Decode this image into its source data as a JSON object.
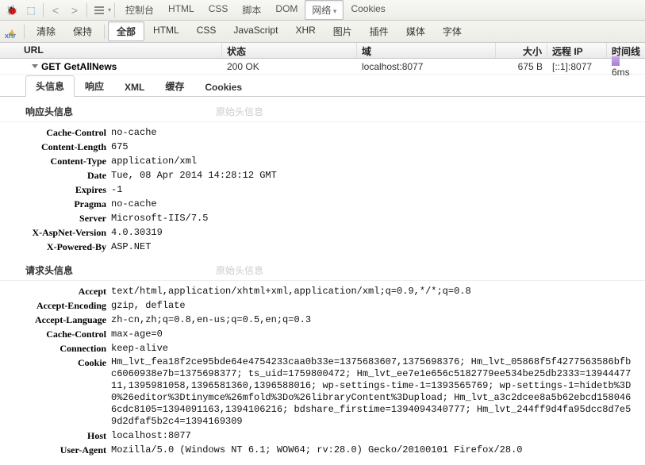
{
  "toolbar1": {
    "tabs": [
      "控制台",
      "HTML",
      "CSS",
      "脚本",
      "DOM",
      "网络",
      "Cookies"
    ],
    "active": 5
  },
  "toolbar2": {
    "left": [
      "清除",
      "保持"
    ],
    "filters": [
      "全部",
      "HTML",
      "CSS",
      "JavaScript",
      "XHR",
      "图片",
      "插件",
      "媒体",
      "字体"
    ],
    "active": 0
  },
  "grid": {
    "headers": {
      "url": "URL",
      "status": "状态",
      "domain": "域",
      "size": "大小",
      "ip": "远程 IP",
      "timeline": "时间线"
    },
    "row": {
      "method": "GET",
      "name": "GetAllNews",
      "status": "200 OK",
      "domain": "localhost:8077",
      "size": "675 B",
      "ip": "[::1]:8077",
      "time": "6ms"
    }
  },
  "subtabs": {
    "items": [
      "头信息",
      "响应",
      "XML",
      "缓存",
      "Cookies"
    ],
    "active": 0
  },
  "response": {
    "title": "响应头信息",
    "raw": "原始头信息",
    "headers": [
      {
        "k": "Cache-Control",
        "v": "no-cache"
      },
      {
        "k": "Content-Length",
        "v": "675"
      },
      {
        "k": "Content-Type",
        "v": "application/xml"
      },
      {
        "k": "Date",
        "v": "Tue, 08 Apr 2014 14:28:12 GMT"
      },
      {
        "k": "Expires",
        "v": "-1"
      },
      {
        "k": "Pragma",
        "v": "no-cache"
      },
      {
        "k": "Server",
        "v": "Microsoft-IIS/7.5"
      },
      {
        "k": "X-AspNet-Version",
        "v": "4.0.30319"
      },
      {
        "k": "X-Powered-By",
        "v": "ASP.NET"
      }
    ]
  },
  "request": {
    "title": "请求头信息",
    "raw": "原始头信息",
    "headers": [
      {
        "k": "Accept",
        "v": "text/html,application/xhtml+xml,application/xml;q=0.9,*/*;q=0.8"
      },
      {
        "k": "Accept-Encoding",
        "v": "gzip, deflate"
      },
      {
        "k": "Accept-Language",
        "v": "zh-cn,zh;q=0.8,en-us;q=0.5,en;q=0.3"
      },
      {
        "k": "Cache-Control",
        "v": "max-age=0"
      },
      {
        "k": "Connection",
        "v": "keep-alive"
      },
      {
        "k": "Cookie",
        "v": "Hm_lvt_fea18f2ce95bde64e4754233caa0b33e=1375683607,1375698376; Hm_lvt_05868f5f4277563586bfbc6060938e7b=1375698377; ts_uid=1759800472; Hm_lvt_ee7e1e656c5182779ee534be25db2333=1394447711,1395981058,1396581360,1396588016; wp-settings-time-1=1393565769; wp-settings-1=hidetb%3D0%26editor%3Dtinymce%26mfold%3Do%26libraryContent%3Dupload; Hm_lvt_a3c2dcee8a5b62ebcd1580466cdc8105=1394091163,1394106216; bdshare_firstime=1394094340777; Hm_lvt_244ff9d4fa95dcc8d7e59d2dfaf5b2c4=1394169309"
      },
      {
        "k": "Host",
        "v": "localhost:8077"
      },
      {
        "k": "User-Agent",
        "v": "Mozilla/5.0 (Windows NT 6.1; WOW64; rv:28.0) Gecko/20100101 Firefox/28.0"
      }
    ]
  }
}
